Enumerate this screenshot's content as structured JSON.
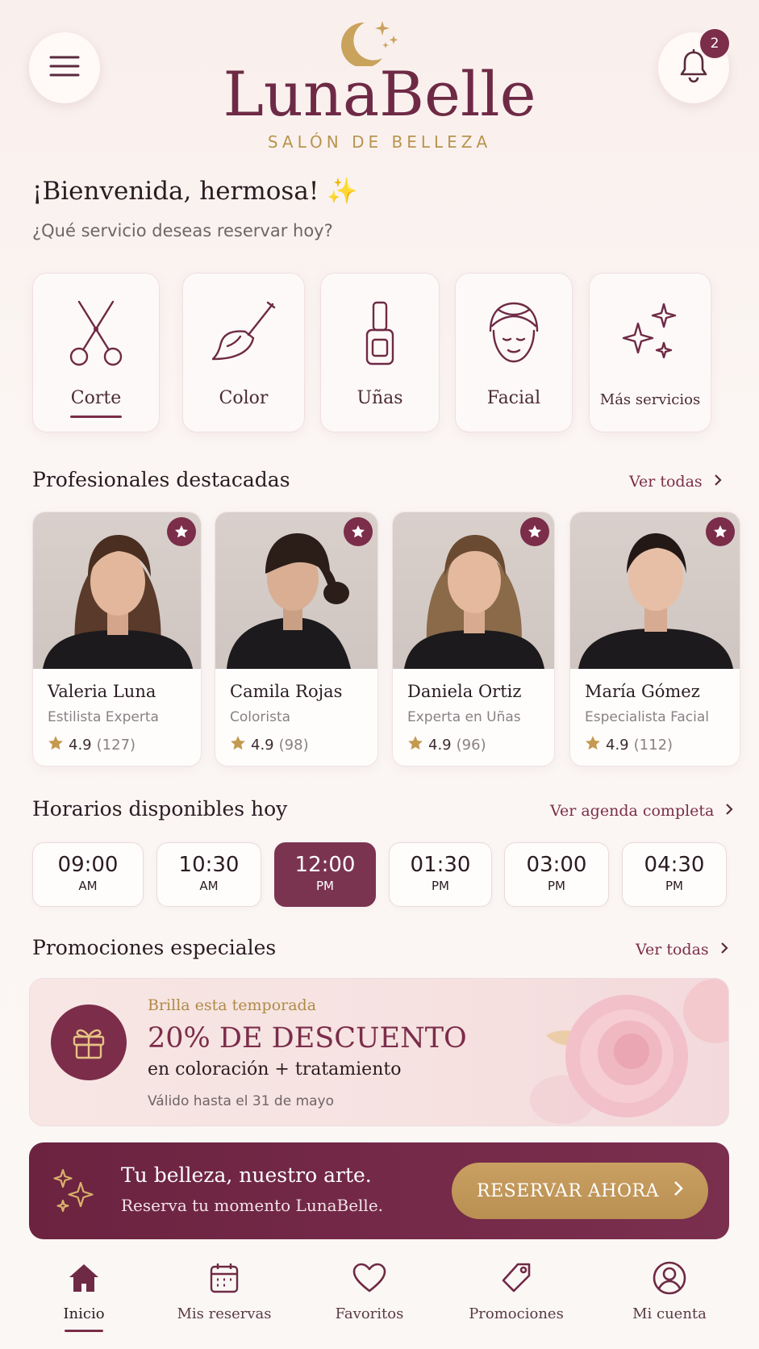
{
  "header": {
    "menu_icon": "hamburger-menu-icon",
    "bell_icon": "bell-icon",
    "notification_count": "2",
    "logo_icon": "crescent-moon-sparkles-icon",
    "brand": "LunaBelle",
    "brand_subtitle": "SALÓN DE BELLEZA"
  },
  "welcome": {
    "title": "¡Bienvenida, hermosa! ✨",
    "subtitle": "¿Qué servicio deseas reservar hoy?"
  },
  "services": [
    {
      "label": "Corte",
      "icon": "scissors-icon",
      "selected": true
    },
    {
      "label": "Color",
      "icon": "brush-icon",
      "selected": false
    },
    {
      "label": "Uñas",
      "icon": "nail-polish-icon",
      "selected": false
    },
    {
      "label": "Facial",
      "icon": "face-towel-icon",
      "selected": false
    },
    {
      "label": "Más servicios",
      "icon": "sparkles-icon",
      "selected": false
    }
  ],
  "professionals": {
    "title": "Profesionales destacadas",
    "link": "Ver todas",
    "items": [
      {
        "name": "Valeria Luna",
        "role": "Estilista Experta",
        "rating": "4.9",
        "reviews": "(127)"
      },
      {
        "name": "Camila Rojas",
        "role": "Colorista",
        "rating": "4.9",
        "reviews": "(98)"
      },
      {
        "name": "Daniela Ortiz",
        "role": "Experta en Uñas",
        "rating": "4.9",
        "reviews": "(96)"
      },
      {
        "name": "María Gómez",
        "role": "Especialista Facial",
        "rating": "4.9",
        "reviews": "(112)"
      }
    ]
  },
  "schedule": {
    "title": "Horarios disponibles hoy",
    "link": "Ver agenda completa",
    "slots": [
      {
        "time": "09:00",
        "period": "AM",
        "selected": false
      },
      {
        "time": "10:30",
        "period": "AM",
        "selected": false
      },
      {
        "time": "12:00",
        "period": "PM",
        "selected": true
      },
      {
        "time": "01:30",
        "period": "PM",
        "selected": false
      },
      {
        "time": "03:00",
        "period": "PM",
        "selected": false
      },
      {
        "time": "04:30",
        "period": "PM",
        "selected": false
      }
    ]
  },
  "promotions": {
    "title": "Promociones especiales",
    "link": "Ver todas",
    "card": {
      "icon": "gift-icon",
      "kicker": "Brilla esta temporada",
      "headline": "20% DE DESCUENTO",
      "detail": "en coloración + tratamiento",
      "validity": "Válido hasta el 31 de mayo"
    }
  },
  "cta": {
    "icon": "sparkles-icon",
    "line1": "Tu belleza, nuestro arte.",
    "line2": "Reserva tu momento LunaBelle.",
    "button": "RESERVAR AHORA"
  },
  "nav": [
    {
      "label": "Inicio",
      "icon": "home-icon",
      "active": true
    },
    {
      "label": "Mis reservas",
      "icon": "calendar-icon",
      "active": false
    },
    {
      "label": "Favoritos",
      "icon": "heart-icon",
      "active": false
    },
    {
      "label": "Promociones",
      "icon": "tag-icon",
      "active": false
    },
    {
      "label": "Mi cuenta",
      "icon": "user-icon",
      "active": false
    }
  ],
  "colors": {
    "primary": "#7b2d4a",
    "gold": "#b8944f",
    "background": "#fbf6f4"
  }
}
